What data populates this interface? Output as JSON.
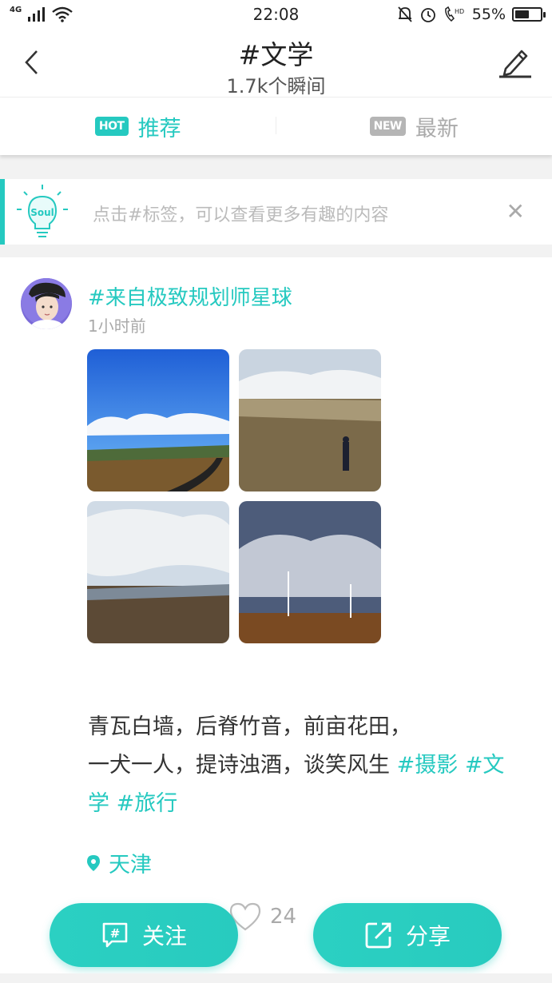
{
  "status_bar": {
    "network": "4G",
    "time": "22:08",
    "battery_percent": "55%",
    "battery_level": 0.55,
    "icons": [
      "signal-icon",
      "wifi-icon",
      "mute-bell-icon",
      "alarm-icon",
      "hd-call-icon",
      "battery-icon"
    ]
  },
  "header": {
    "title": "#文学",
    "subtitle": "1.7k个瞬间",
    "back_icon": "chevron-left-icon",
    "edit_icon": "pencil-icon"
  },
  "tabs": [
    {
      "badge": "HOT",
      "label": "推荐",
      "active": true
    },
    {
      "badge": "NEW",
      "label": "最新",
      "active": false
    }
  ],
  "tip": {
    "icon_label": "Soul",
    "text": "点击#标签，可以查看更多有趣的内容",
    "close_icon": "close-icon"
  },
  "post": {
    "tag": "#来自极致规划师星球",
    "time": "1小时前",
    "text_line1": "青瓦白墙，后脊竹音，前亩花田，",
    "text_line2_plain": "一犬一人，提诗浊酒，谈笑风生 ",
    "tags": [
      "#摄影",
      "#文学",
      "#旅行"
    ],
    "location": "天津",
    "likes": "24"
  },
  "actions": {
    "follow_label": "关注",
    "share_label": "分享"
  },
  "colors": {
    "accent": "#25c9c0",
    "inactive": "#aaaaaa",
    "band": "#f2f2f2"
  }
}
